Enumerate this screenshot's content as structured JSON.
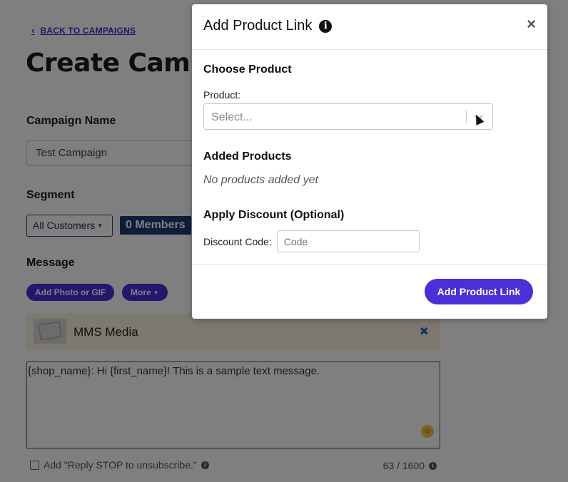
{
  "background": {
    "back_link": "BACK TO CAMPAIGNS",
    "page_title": "Create Campaign",
    "campaign_name_label": "Campaign Name",
    "campaign_name_value": "Test Campaign",
    "segment_label": "Segment",
    "segment_value": "All Customers",
    "members_badge": "0 Members",
    "message_label": "Message",
    "add_photo_label": "Add Photo or GIF",
    "more_label": "More",
    "media_label": "MMS Media",
    "message_text": "{shop_name}: Hi {first_name}! This is a sample text message.",
    "reply_stop_label": "Add \"Reply STOP to unsubscribe.\"",
    "char_counter": "63 / 1600"
  },
  "modal": {
    "title": "Add Product Link",
    "choose_product_heading": "Choose Product",
    "product_label": "Product:",
    "product_placeholder": "Select...",
    "added_products_heading": "Added Products",
    "no_products_text": "No products added yet",
    "apply_discount_heading": "Apply Discount (Optional)",
    "discount_code_label": "Discount Code:",
    "discount_code_placeholder": "Code",
    "submit_label": "Add Product Link"
  },
  "colors": {
    "accent": "#4b2fd8",
    "badge": "#1d3a72",
    "media_bar": "#faf1e0"
  }
}
